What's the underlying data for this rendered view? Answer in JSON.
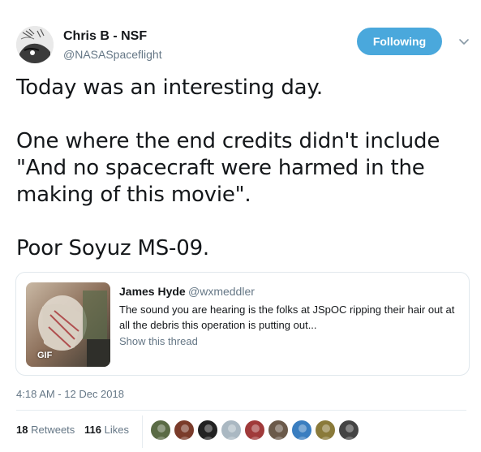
{
  "author": {
    "name": "Chris B - NSF",
    "handle": "@NASASpaceflight",
    "avatar_icon": "avatar-rocket-drawing"
  },
  "follow_button": {
    "label": "Following",
    "color": "#4aa8dc"
  },
  "menu_icon": "chevron-down-icon",
  "tweet": {
    "lines": [
      "Today was an interesting day.",
      "",
      "One where the end credits didn't include",
      "\"And no spacecraft were harmed in the",
      "making of this movie\".",
      "",
      "Poor Soyuz MS-09."
    ]
  },
  "quoted_tweet": {
    "name": "James Hyde",
    "handle": "@wxmeddler",
    "text": "The sound you are hearing is the folks at JSpOC ripping their hair out at all the debris this operation is putting out...",
    "link": "Show this thread",
    "media_badge": "GIF"
  },
  "timestamp": "4:18 AM - 12 Dec 2018",
  "stats": {
    "retweets_count": "18",
    "retweets_label": "Retweets",
    "likes_count": "116",
    "likes_label": "Likes"
  },
  "likers": [
    {
      "color": "#5a6b45"
    },
    {
      "color": "#7a3b2a"
    },
    {
      "color": "#222222"
    },
    {
      "color": "#aab8c2"
    },
    {
      "color": "#a03a3a"
    },
    {
      "color": "#6b5a4a"
    },
    {
      "color": "#3a7ec0"
    },
    {
      "color": "#8a7a3a"
    },
    {
      "color": "#444444"
    }
  ]
}
